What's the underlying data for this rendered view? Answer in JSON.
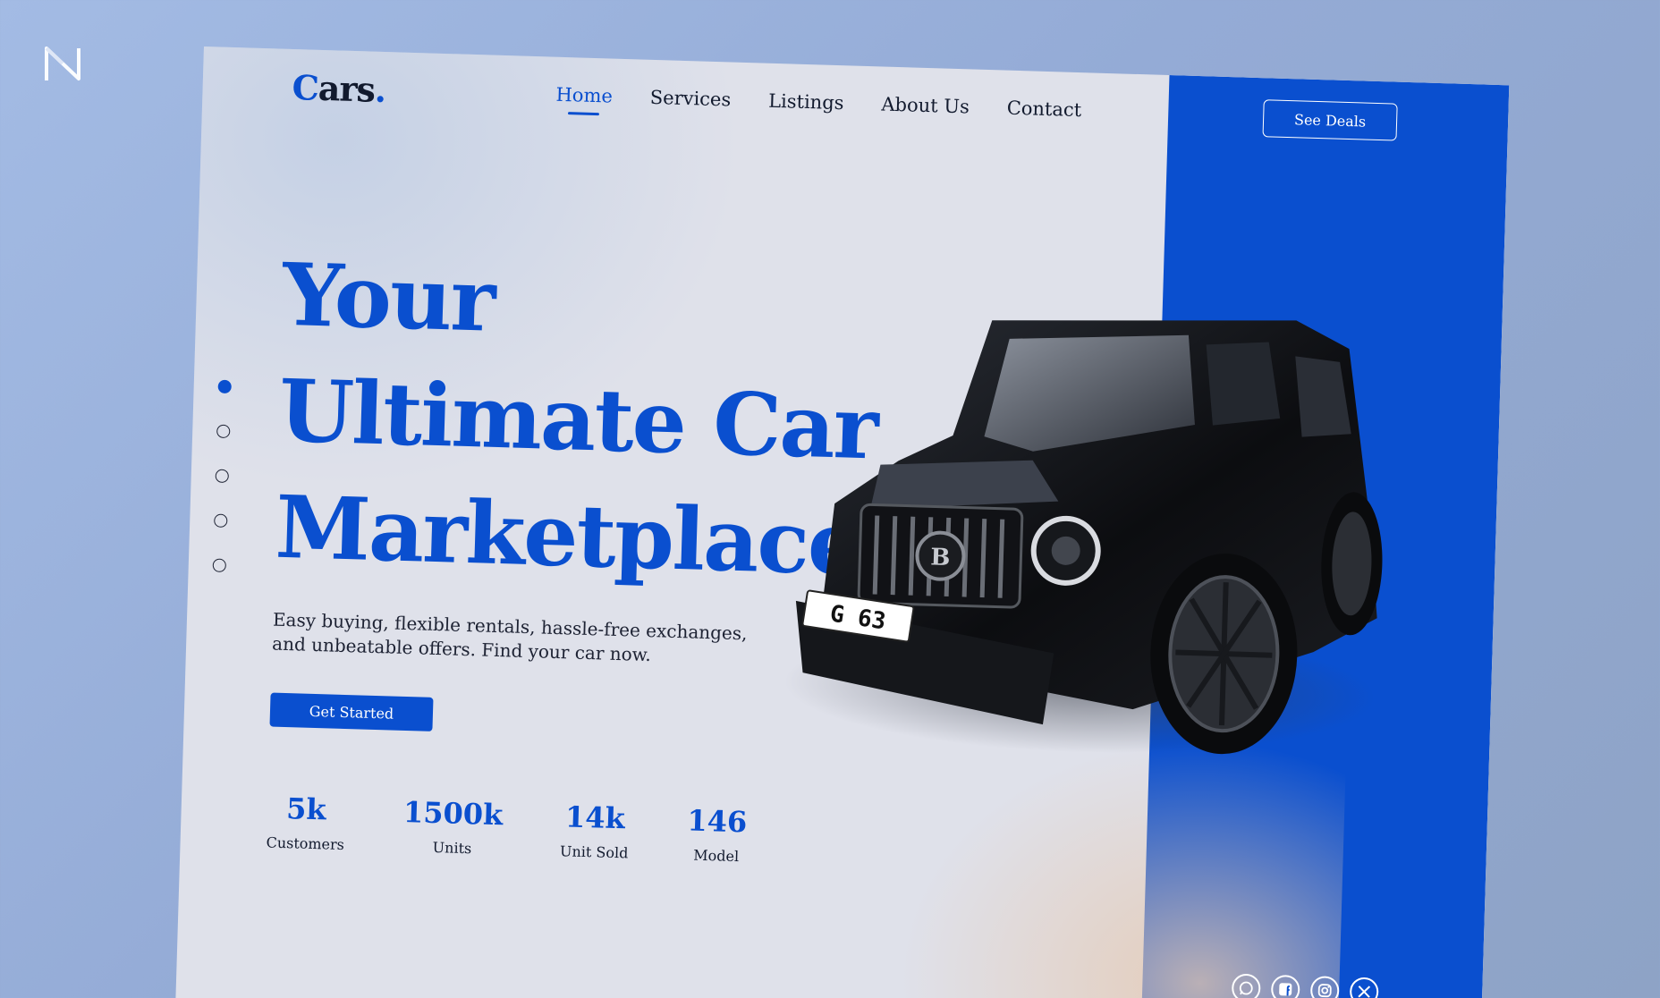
{
  "brand": {
    "logo_text_lead": "C",
    "logo_text_rest": "ars",
    "logo_dot": "."
  },
  "nav": {
    "items": [
      {
        "label": "Home",
        "active": true
      },
      {
        "label": "Services",
        "active": false
      },
      {
        "label": "Listings",
        "active": false
      },
      {
        "label": "About Us",
        "active": false
      },
      {
        "label": "Contact",
        "active": false
      }
    ]
  },
  "header": {
    "cta_label": "See Deals"
  },
  "hero": {
    "title_lines": [
      "Your",
      "Ultimate Car",
      "Marketplace"
    ],
    "subtitle": "Easy buying, flexible rentals, hassle-free exchanges, and unbeatable offers. Find your car now.",
    "cta_label": "Get Started",
    "slide_count": 5,
    "active_slide": 1
  },
  "stats": [
    {
      "value": "5k",
      "label": "Customers"
    },
    {
      "value": "1500k",
      "label": "Units"
    },
    {
      "value": "14k",
      "label": "Unit Sold"
    },
    {
      "value": "146",
      "label": "Model"
    }
  ],
  "car": {
    "plate": "G 63",
    "badge": "B"
  },
  "socials": [
    {
      "icon": "whatsapp-icon"
    },
    {
      "icon": "facebook-icon"
    },
    {
      "icon": "instagram-icon"
    },
    {
      "icon": "x-icon"
    }
  ],
  "colors": {
    "accent": "#0a4fcf",
    "ink": "#121a2e",
    "panel_bg": "#dfe1ea",
    "page_bg": "#97afd8"
  }
}
